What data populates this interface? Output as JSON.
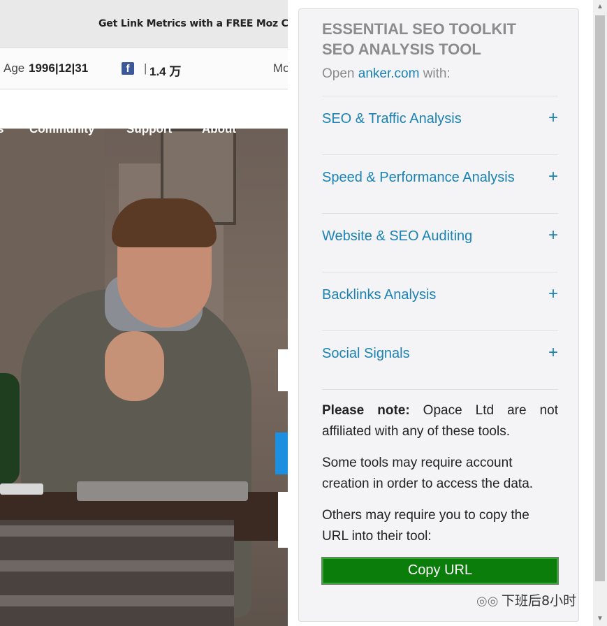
{
  "background_page": {
    "banner_text": "Get Link Metrics with a FREE Moz Co",
    "metrics": {
      "age_label": "Age",
      "age_value": "1996|12|31",
      "facebook_icon": "facebook-icon",
      "separator": "|",
      "facebook_count": "1.4 万",
      "more_label": "Mo"
    },
    "hero_nav": [
      "s",
      "Community",
      "Support",
      "About"
    ]
  },
  "popup": {
    "title_line1": "ESSENTIAL SEO TOOLKIT",
    "title_line2": "SEO ANALYSIS TOOL",
    "open_prefix": "Open ",
    "open_domain": "anker.com",
    "open_suffix": " with:",
    "sections": [
      {
        "label": "SEO & Traffic Analysis",
        "icon": "+"
      },
      {
        "label": "Speed & Performance Analysis",
        "icon": "+"
      },
      {
        "label": "Website & SEO Auditing",
        "icon": "+"
      },
      {
        "label": "Backlinks Analysis",
        "icon": "+"
      },
      {
        "label": "Social Signals",
        "icon": "+"
      }
    ],
    "note_label": "Please note:",
    "note_text": " Opace Ltd are not affiliated with any of these tools.",
    "note2": "Some tools may require account creation in order to access the data.",
    "note3": "Others may require you to copy the URL into their tool:",
    "copy_button": "Copy URL"
  },
  "watermark": {
    "icon": "wechat-icon",
    "text": "下班后8小时"
  },
  "colors": {
    "link": "#1a82b4",
    "button_green": "#0a7d0a",
    "title_gray": "#8b8b8b"
  }
}
